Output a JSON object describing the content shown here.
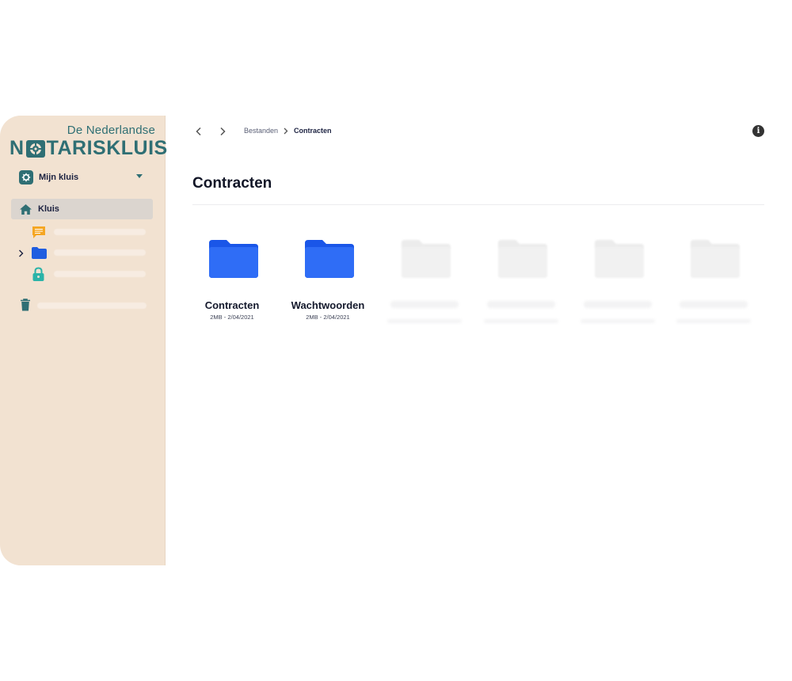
{
  "brand": {
    "subtitle": "De Nederlandse",
    "name_prefix": "N",
    "name_suffix": "TARISKLUIS",
    "color": "#2f6f74"
  },
  "sidebar": {
    "vault_selector": {
      "label": "Mijn kluis",
      "icon": "gear-icon"
    },
    "nav": [
      {
        "label": "Kluis",
        "icon": "home-icon",
        "active": true
      },
      {
        "icon": "chat-icon",
        "color": "#f5a623"
      },
      {
        "icon": "folder-icon",
        "color": "#1f5de0"
      },
      {
        "icon": "lock-icon",
        "color": "#2bb3a8"
      },
      {
        "icon": "trash-icon",
        "color": "#2f6f74"
      }
    ]
  },
  "toolbar": {
    "back_icon": "chevron-left-icon",
    "forward_icon": "chevron-right-icon",
    "info_icon": "info-icon",
    "info_glyph": "i"
  },
  "breadcrumb": {
    "items": [
      "Bestanden",
      "Contracten"
    ]
  },
  "page": {
    "title": "Contracten"
  },
  "folders": [
    {
      "name": "Contracten",
      "meta": "2MB - 2/04/2021"
    },
    {
      "name": "Wachtwoorden",
      "meta": "2MB - 2/04/2021"
    }
  ],
  "colors": {
    "sidebar_bg": "#f2e2d1",
    "folder": "#1f5de0",
    "placeholder_folder": "#efefef"
  }
}
